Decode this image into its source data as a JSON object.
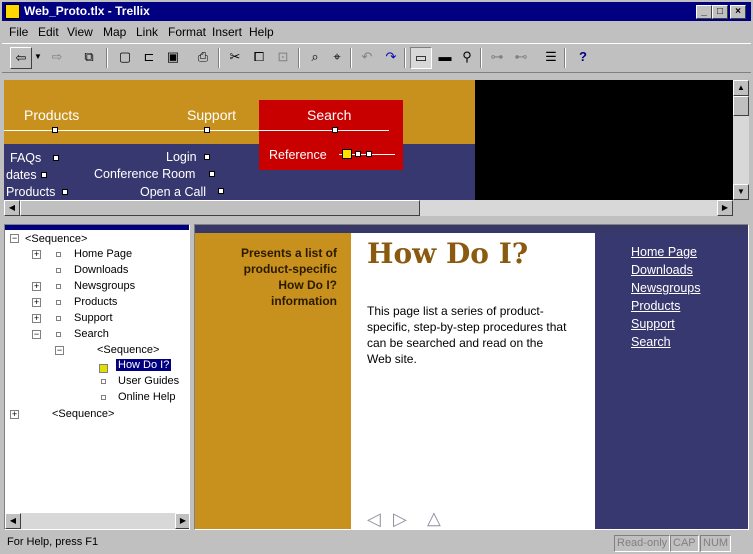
{
  "window": {
    "title": "Web_Proto.tlx - Trellix",
    "min": "_",
    "max": "□",
    "close": "×"
  },
  "menu": [
    "File",
    "Edit",
    "View",
    "Map",
    "Link",
    "Format",
    "Insert",
    "Help"
  ],
  "toolbar": {
    "icons": [
      "back-icon",
      "dropdown-icon",
      "forward-icon",
      "sitemap-icon",
      "new-icon",
      "open-icon",
      "save-icon",
      "print-icon",
      "cut-icon",
      "copy-icon",
      "paste-icon",
      "find-icon",
      "find-replace-icon",
      "undo-icon",
      "redo-icon",
      "page-view-icon",
      "map-view-icon",
      "zoom-icon",
      "link-icon",
      "unlink-icon",
      "sequence-icon",
      "help-icon"
    ]
  },
  "map": {
    "top_nodes": [
      "Products",
      "Support",
      "Search"
    ],
    "products_children": [
      "FAQs",
      "dates",
      "Products"
    ],
    "support_children": [
      "Login",
      "Conference Room",
      "Open a Call"
    ],
    "search_children": [
      "Reference"
    ]
  },
  "tree": {
    "seq1": "<Sequence>",
    "items": [
      "Home Page",
      "Downloads",
      "Newsgroups",
      "Products",
      "Support",
      "Search"
    ],
    "seq2": "<Sequence>",
    "sub": [
      "How Do I?",
      "User Guides",
      "Online Help"
    ],
    "seq3": "<Sequence>"
  },
  "page": {
    "sidebar_text": "Presents a list of product-specific How Do I? information",
    "heading": "How Do I?",
    "body": "This page list a series of product-specific, step-by-step procedures that can be searched and read on the Web site.",
    "nav": [
      "Home Page",
      "Downloads",
      "Newsgroups",
      "Products",
      "Support",
      "Search"
    ]
  },
  "status": {
    "help": "For Help, press F1",
    "ro": "Read-only",
    "cap": "CAP",
    "num": "NUM"
  },
  "colors": {
    "gold": "#c8901c",
    "navy": "#383870",
    "red": "#c80000",
    "title": "#000080"
  }
}
